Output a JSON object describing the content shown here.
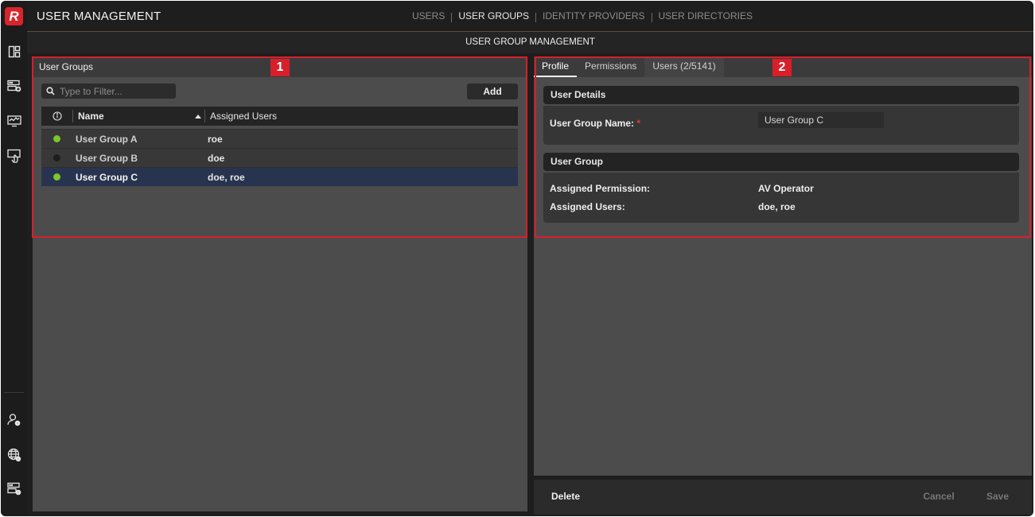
{
  "app": {
    "logo_letter": "R",
    "title": "USER MANAGEMENT"
  },
  "top_nav": [
    {
      "label": "USERS",
      "active": false
    },
    {
      "label": "USER GROUPS",
      "active": true
    },
    {
      "label": "IDENTITY PROVIDERS",
      "active": false
    },
    {
      "label": "USER DIRECTORIES",
      "active": false
    }
  ],
  "rail_icons": [
    "dashboard-icon",
    "server-add-icon",
    "monitor-icon",
    "touch-panel-icon",
    "user-settings-icon",
    "globe-settings-icon",
    "server-settings-icon"
  ],
  "page_header": "USER GROUP MANAGEMENT",
  "left_panel": {
    "title": "User Groups",
    "filter_placeholder": "Type to Filter...",
    "add_label": "Add",
    "columns": {
      "status": "info-icon",
      "name": "Name",
      "users": "Assigned Users",
      "sort": "ascending"
    },
    "rows": [
      {
        "name": "User Group A",
        "users": "roe",
        "status_color": "#7cc628",
        "selected": false
      },
      {
        "name": "User Group B",
        "users": "doe",
        "status_color": "#1e1e1e",
        "selected": false
      },
      {
        "name": "User Group C",
        "users": "doe, roe",
        "status_color": "#7cc628",
        "selected": true
      }
    ]
  },
  "annotations": {
    "one": "1",
    "two": "2"
  },
  "right_panel": {
    "tabs": [
      {
        "label": "Profile",
        "active": true
      },
      {
        "label": "Permissions",
        "active": false
      },
      {
        "label": "Users (2/5141)",
        "active": false
      }
    ],
    "user_details": {
      "title": "User Details",
      "name_label": "User Group Name:",
      "required_mark": "*",
      "name_value": "User Group C"
    },
    "user_group": {
      "title": "User Group",
      "permission_label": "Assigned Permission:",
      "permission_value": "AV Operator",
      "users_label": "Assigned Users:",
      "users_value": "doe, roe"
    }
  },
  "footer": {
    "delete_label": "Delete",
    "cancel_label": "Cancel",
    "save_label": "Save"
  },
  "colors": {
    "accent_red": "#d81f2a",
    "status_green": "#7cc628",
    "selected_row": "#28344f",
    "nav_underline": "#a88b6a"
  }
}
